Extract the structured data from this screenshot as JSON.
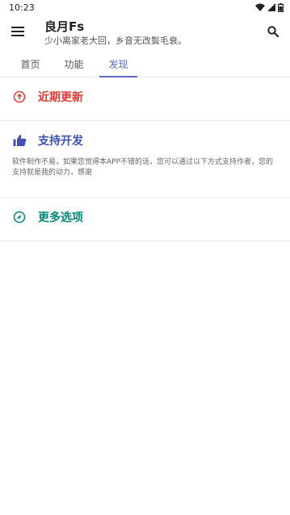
{
  "status_bar": {
    "time": "10:23"
  },
  "app_bar": {
    "title": "良月Fs",
    "subtitle": "少小离家老大回，乡音无改鬓毛衰。"
  },
  "tabs": [
    {
      "label": "首页"
    },
    {
      "label": "功能"
    },
    {
      "label": "发现",
      "active": true
    }
  ],
  "sections": [
    {
      "label": "近期更新",
      "icon": "arrow-up-circle-icon",
      "color": "#e53935"
    },
    {
      "label": "支持开发",
      "icon": "thumb-up-icon",
      "color": "#3f51b5",
      "description": "软件制作不易，如果您觉得本APP不错的话，您可以通过以下方式支持作者，您的支持就是我的动力，感谢"
    },
    {
      "label": "更多选项",
      "icon": "compass-icon",
      "color": "#00897b"
    }
  ],
  "colors": {
    "accent": "#5b6bc0"
  }
}
